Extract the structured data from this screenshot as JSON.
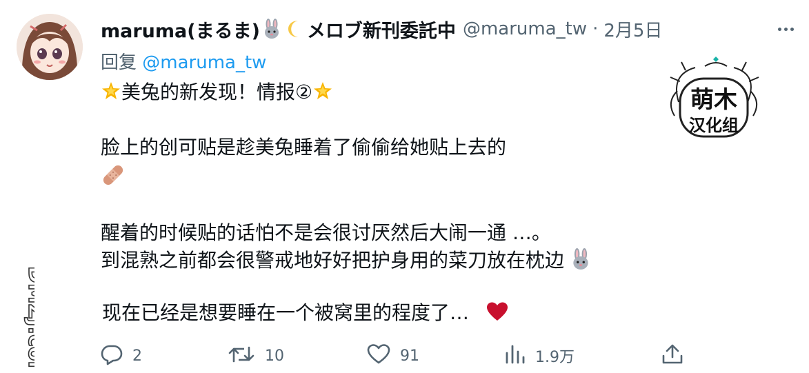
{
  "tweet": {
    "display_name": "maruma(まるま)",
    "name_suffix": "メロブ新刊委託中",
    "handle": "@maruma_tw",
    "separator": "·",
    "date": "2月5日",
    "reply_prefix": "回复",
    "reply_to": "@maruma_tw",
    "lines": [
      "美兔的新发现！情报②",
      "脸上的创可贴是趁美兔睡着了偷偷给她贴上去的",
      "醒着的时候贴的话怕不是会很讨厌然后大闹一通 …。",
      "到混熟之前都会很警戒地好好把护身用的菜刀放在枕边",
      "现在已经是想要睡在一个被窝里的程度了…"
    ]
  },
  "watermark": {
    "line1": "萌木",
    "line2": "汉化组"
  },
  "side_watermark": "DMZJ.com",
  "actions": {
    "replies": "2",
    "retweets": "10",
    "likes": "91",
    "views": "1.9万"
  },
  "icons": [
    "avatar",
    "rabbit-emoji",
    "crescent-moon-emoji",
    "glowing-star-emoji",
    "adhesive-bandage-emoji",
    "red-heart-emoji",
    "more-icon",
    "reply-icon",
    "retweet-icon",
    "like-icon",
    "views-icon",
    "share-icon"
  ],
  "colors": {
    "text": "#0f1419",
    "secondary": "#536471",
    "link": "#1d9bf0",
    "heart": "#c8102e"
  }
}
